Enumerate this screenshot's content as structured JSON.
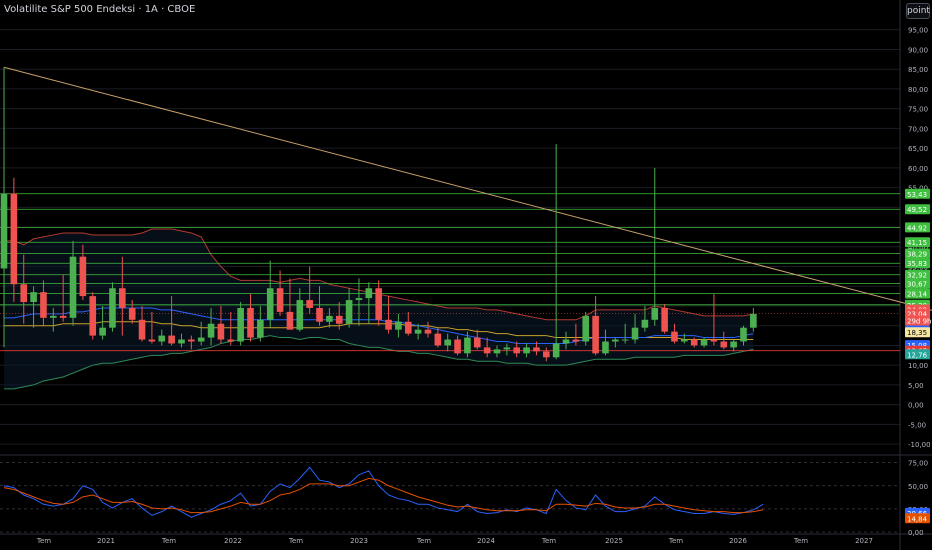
{
  "header": {
    "title": "Volatilite S&P 500 Endeksi · 1A · CBOE",
    "scale_button": "point"
  },
  "colors": {
    "up": "#26a69a",
    "up_fill": "#4caf50",
    "down": "#ef5350",
    "trendline": "#c8a06a",
    "hline": "#3fbf3f",
    "support": "#e53935",
    "bb_upper": "#b23b2f",
    "bb_lower": "#2e8b57",
    "ma_blue": "#2962ff",
    "ma_orange": "#c9a227",
    "grid": "#1a1d24",
    "text": "#d1d4dc"
  },
  "chart_data": [
    {
      "type": "candlestick",
      "title": "Volatilite S&P 500 Endeksi · 1A · CBOE",
      "ylim": [
        -12,
        100
      ],
      "x_tick_labels": [
        "Tem",
        "2021",
        "Tem",
        "2022",
        "Tem",
        "2023",
        "Tem",
        "2024",
        "Tem",
        "2025",
        "Tem",
        "2026",
        "Tem",
        "2027"
      ],
      "y_tick_labels": [
        "95,00",
        "90,00",
        "85,00",
        "80,00",
        "75,00",
        "70,00",
        "65,00",
        "60,00",
        "55,00",
        "50,00",
        "45,00",
        "40,00",
        "35,00",
        "30,00",
        "25,00",
        "20,00",
        "15,00",
        "10,00",
        "5,00",
        "0,00",
        "-5,00",
        "-10,00"
      ],
      "y_ticks": [
        95,
        90,
        85,
        80,
        75,
        70,
        65,
        60,
        55,
        50,
        45,
        40,
        35,
        30,
        25,
        20,
        15,
        10,
        5,
        0,
        -5,
        -10
      ],
      "candles": [
        {
          "o": 34.5,
          "h": 85.5,
          "l": 14.5,
          "c": 53.5
        },
        {
          "o": 53.5,
          "h": 57.5,
          "l": 26.0,
          "c": 30.5
        },
        {
          "o": 30.5,
          "h": 38.0,
          "l": 20.5,
          "c": 26.0
        },
        {
          "o": 26.0,
          "h": 30.0,
          "l": 19.5,
          "c": 28.5
        },
        {
          "o": 28.5,
          "h": 31.5,
          "l": 20.0,
          "c": 22.0
        },
        {
          "o": 22.0,
          "h": 24.5,
          "l": 18.5,
          "c": 22.5
        },
        {
          "o": 22.5,
          "h": 33.0,
          "l": 21.0,
          "c": 22.0
        },
        {
          "o": 22.0,
          "h": 41.5,
          "l": 20.0,
          "c": 37.5
        },
        {
          "o": 37.5,
          "h": 40.5,
          "l": 26.5,
          "c": 27.5
        },
        {
          "o": 27.5,
          "h": 28.5,
          "l": 16.5,
          "c": 17.5
        },
        {
          "o": 17.5,
          "h": 25.0,
          "l": 16.5,
          "c": 19.5
        },
        {
          "o": 19.5,
          "h": 31.0,
          "l": 18.5,
          "c": 29.5
        },
        {
          "o": 29.5,
          "h": 37.5,
          "l": 17.5,
          "c": 24.5
        },
        {
          "o": 24.5,
          "h": 26.5,
          "l": 20.5,
          "c": 21.5
        },
        {
          "o": 21.5,
          "h": 25.0,
          "l": 16.0,
          "c": 16.5
        },
        {
          "o": 16.5,
          "h": 23.5,
          "l": 15.5,
          "c": 16.0
        },
        {
          "o": 16.0,
          "h": 19.0,
          "l": 15.0,
          "c": 17.5
        },
        {
          "o": 17.5,
          "h": 27.5,
          "l": 15.0,
          "c": 15.5
        },
        {
          "o": 15.5,
          "h": 18.0,
          "l": 14.5,
          "c": 16.5
        },
        {
          "o": 16.5,
          "h": 17.5,
          "l": 14.0,
          "c": 16.0
        },
        {
          "o": 16.0,
          "h": 21.0,
          "l": 15.0,
          "c": 17.0
        },
        {
          "o": 17.0,
          "h": 24.5,
          "l": 15.0,
          "c": 20.5
        },
        {
          "o": 20.5,
          "h": 25.0,
          "l": 15.5,
          "c": 16.5
        },
        {
          "o": 16.5,
          "h": 23.5,
          "l": 15.0,
          "c": 16.0
        },
        {
          "o": 16.0,
          "h": 26.0,
          "l": 15.0,
          "c": 24.5
        },
        {
          "o": 24.5,
          "h": 28.0,
          "l": 16.0,
          "c": 17.0
        },
        {
          "o": 17.0,
          "h": 25.0,
          "l": 16.0,
          "c": 21.5
        },
        {
          "o": 21.5,
          "h": 36.5,
          "l": 19.5,
          "c": 29.5
        },
        {
          "o": 29.5,
          "h": 34.0,
          "l": 22.5,
          "c": 23.5
        },
        {
          "o": 23.5,
          "h": 32.0,
          "l": 19.5,
          "c": 19.0
        },
        {
          "o": 19.0,
          "h": 29.5,
          "l": 18.5,
          "c": 26.5
        },
        {
          "o": 26.5,
          "h": 35.0,
          "l": 23.0,
          "c": 24.5
        },
        {
          "o": 24.5,
          "h": 30.0,
          "l": 20.0,
          "c": 21.0
        },
        {
          "o": 21.0,
          "h": 24.5,
          "l": 19.5,
          "c": 22.5
        },
        {
          "o": 22.5,
          "h": 26.0,
          "l": 19.0,
          "c": 20.5
        },
        {
          "o": 20.5,
          "h": 29.5,
          "l": 19.5,
          "c": 26.5
        },
        {
          "o": 26.5,
          "h": 32.0,
          "l": 20.0,
          "c": 27.0
        },
        {
          "o": 27.0,
          "h": 31.0,
          "l": 20.5,
          "c": 29.5
        },
        {
          "o": 29.5,
          "h": 31.5,
          "l": 20.0,
          "c": 21.5
        },
        {
          "o": 21.5,
          "h": 27.5,
          "l": 18.0,
          "c": 19.0
        },
        {
          "o": 19.0,
          "h": 23.0,
          "l": 17.0,
          "c": 21.0
        },
        {
          "o": 21.0,
          "h": 23.5,
          "l": 17.5,
          "c": 18.0
        },
        {
          "o": 18.0,
          "h": 20.5,
          "l": 16.5,
          "c": 19.0
        },
        {
          "o": 19.0,
          "h": 21.0,
          "l": 17.0,
          "c": 18.0
        },
        {
          "o": 18.0,
          "h": 19.5,
          "l": 14.5,
          "c": 15.0
        },
        {
          "o": 15.0,
          "h": 18.0,
          "l": 13.5,
          "c": 16.5
        },
        {
          "o": 16.5,
          "h": 17.5,
          "l": 12.5,
          "c": 13.0
        },
        {
          "o": 13.0,
          "h": 18.5,
          "l": 12.0,
          "c": 17.0
        },
        {
          "o": 17.0,
          "h": 19.0,
          "l": 14.0,
          "c": 14.5
        },
        {
          "o": 14.5,
          "h": 17.0,
          "l": 12.0,
          "c": 13.0
        },
        {
          "o": 13.0,
          "h": 15.0,
          "l": 12.0,
          "c": 14.0
        },
        {
          "o": 14.0,
          "h": 15.5,
          "l": 12.5,
          "c": 14.5
        },
        {
          "o": 14.5,
          "h": 16.0,
          "l": 12.0,
          "c": 13.0
        },
        {
          "o": 13.0,
          "h": 15.5,
          "l": 12.0,
          "c": 14.5
        },
        {
          "o": 14.5,
          "h": 16.0,
          "l": 12.5,
          "c": 13.5
        },
        {
          "o": 13.5,
          "h": 14.5,
          "l": 11.0,
          "c": 12.0
        },
        {
          "o": 12.0,
          "h": 66.0,
          "l": 11.5,
          "c": 15.5
        },
        {
          "o": 15.5,
          "h": 18.5,
          "l": 14.0,
          "c": 16.5
        },
        {
          "o": 16.5,
          "h": 20.5,
          "l": 15.0,
          "c": 16.0
        },
        {
          "o": 16.0,
          "h": 23.5,
          "l": 15.0,
          "c": 22.5
        },
        {
          "o": 22.5,
          "h": 27.5,
          "l": 12.5,
          "c": 13.0
        },
        {
          "o": 13.0,
          "h": 19.0,
          "l": 12.5,
          "c": 16.0
        },
        {
          "o": 16.0,
          "h": 17.0,
          "l": 14.5,
          "c": 16.5
        },
        {
          "o": 16.5,
          "h": 20.5,
          "l": 15.5,
          "c": 16.5
        },
        {
          "o": 16.5,
          "h": 23.0,
          "l": 15.5,
          "c": 19.5
        },
        {
          "o": 19.5,
          "h": 25.0,
          "l": 18.5,
          "c": 21.5
        },
        {
          "o": 21.5,
          "h": 60.0,
          "l": 20.0,
          "c": 24.5
        },
        {
          "o": 24.5,
          "h": 25.5,
          "l": 18.0,
          "c": 18.5
        },
        {
          "o": 18.5,
          "h": 20.5,
          "l": 15.5,
          "c": 16.0
        },
        {
          "o": 16.0,
          "h": 18.0,
          "l": 15.5,
          "c": 16.5
        },
        {
          "o": 16.5,
          "h": 17.0,
          "l": 14.5,
          "c": 15.0
        },
        {
          "o": 15.0,
          "h": 17.0,
          "l": 14.5,
          "c": 16.5
        },
        {
          "o": 16.5,
          "h": 28.0,
          "l": 15.0,
          "c": 16.0
        },
        {
          "o": 16.0,
          "h": 18.5,
          "l": 14.0,
          "c": 14.5
        },
        {
          "o": 14.5,
          "h": 16.5,
          "l": 13.5,
          "c": 16.0
        },
        {
          "o": 16.0,
          "h": 20.0,
          "l": 15.0,
          "c": 19.5
        },
        {
          "o": 19.5,
          "h": 24.5,
          "l": 18.5,
          "c": 23.0
        }
      ],
      "horizontal_levels": [
        53.43,
        49.52,
        44.92,
        41.15,
        38.29,
        35.83,
        32.92,
        30.67,
        28.14,
        25.3
      ],
      "support_level": 13.67,
      "trendline": {
        "from": [
          0,
          85.5
        ],
        "to": [
          110,
          13.5
        ]
      },
      "bb_upper": [
        41.5,
        41.5,
        40.5,
        42.0,
        42.5,
        43.0,
        43.5,
        43.5,
        43.5,
        43.0,
        43.0,
        43.0,
        43.0,
        43.0,
        43.5,
        44.5,
        44.5,
        44.5,
        44.0,
        43.5,
        42.5,
        38.0,
        35.0,
        32.5,
        31.5,
        31.5,
        31.5,
        31.5,
        31.0,
        31.5,
        32.0,
        31.5,
        31.5,
        30.5,
        30.0,
        29.5,
        29.0,
        28.5,
        28.0,
        27.5,
        27.0,
        26.5,
        26.0,
        25.5,
        25.0,
        24.5,
        24.5,
        24.5,
        24.5,
        24.0,
        24.0,
        23.5,
        23.0,
        22.5,
        22.0,
        21.5,
        21.5,
        21.5,
        21.5,
        22.5,
        24.0,
        24.0,
        24.0,
        24.0,
        24.0,
        24.0,
        25.0,
        24.5,
        24.0,
        23.5,
        23.0,
        22.5,
        22.5,
        22.5,
        22.5,
        22.5,
        23.0
      ],
      "bb_lower": [
        4.0,
        4.0,
        4.5,
        5.0,
        6.0,
        6.5,
        7.0,
        8.0,
        9.0,
        10.0,
        10.5,
        10.5,
        11.0,
        11.5,
        12.0,
        12.5,
        12.5,
        13.0,
        13.0,
        13.5,
        14.0,
        14.5,
        15.5,
        16.0,
        16.5,
        16.5,
        17.0,
        17.5,
        17.0,
        17.0,
        16.5,
        17.0,
        17.0,
        16.5,
        16.5,
        15.5,
        15.0,
        14.5,
        14.5,
        14.0,
        13.5,
        13.5,
        13.0,
        13.0,
        12.5,
        12.0,
        11.5,
        11.5,
        11.0,
        11.0,
        11.0,
        10.5,
        10.5,
        10.5,
        10.0,
        10.0,
        10.0,
        10.0,
        10.5,
        11.0,
        11.5,
        11.5,
        11.5,
        11.5,
        12.0,
        12.0,
        12.0,
        12.0,
        12.0,
        12.5,
        12.5,
        12.5,
        12.5,
        12.5,
        13.0,
        13.5,
        14.0
      ],
      "ma_blue": [
        22.0,
        22.0,
        22.5,
        23.0,
        23.0,
        23.0,
        23.0,
        23.5,
        23.5,
        24.0,
        24.5,
        24.5,
        24.5,
        24.5,
        24.5,
        24.5,
        24.0,
        24.0,
        23.5,
        23.0,
        22.5,
        22.0,
        21.5,
        21.5,
        21.5,
        21.5,
        21.5,
        21.5,
        21.5,
        21.5,
        21.5,
        21.5,
        21.5,
        21.5,
        21.5,
        21.5,
        21.5,
        21.5,
        21.5,
        21.0,
        21.0,
        20.5,
        20.0,
        19.5,
        19.0,
        18.5,
        18.0,
        17.5,
        17.0,
        16.5,
        16.0,
        16.0,
        15.5,
        15.5,
        15.5,
        15.5,
        15.5,
        15.5,
        16.0,
        16.5,
        17.0,
        17.0,
        17.0,
        17.0,
        17.0,
        17.0,
        17.5,
        17.5,
        17.5,
        17.5,
        17.5,
        17.0,
        17.0,
        17.0,
        17.0,
        17.5,
        18.0
      ],
      "ma_orange": [
        20.0,
        20.0,
        20.0,
        20.0,
        20.0,
        20.0,
        20.5,
        20.5,
        20.5,
        20.5,
        21.0,
        21.0,
        21.0,
        21.0,
        21.0,
        21.0,
        20.5,
        20.5,
        20.0,
        20.0,
        19.5,
        19.5,
        19.5,
        19.5,
        19.5,
        19.5,
        19.5,
        19.5,
        19.5,
        19.5,
        19.5,
        19.5,
        19.5,
        20.0,
        20.0,
        20.5,
        20.5,
        20.5,
        20.5,
        20.5,
        20.5,
        20.0,
        20.0,
        20.0,
        19.5,
        19.5,
        19.0,
        19.0,
        18.5,
        18.5,
        18.0,
        18.0,
        17.5,
        17.5,
        17.5,
        17.5,
        17.0,
        17.0,
        17.0,
        17.0,
        17.0,
        17.0,
        17.0,
        17.0,
        17.0,
        17.0,
        17.0,
        17.0,
        17.0,
        16.5,
        16.5,
        16.5,
        16.5,
        16.5,
        16.5,
        16.5,
        16.5
      ],
      "price_labels": [
        {
          "text": "53,43",
          "value": 53.43,
          "bg": "#3fbf3f"
        },
        {
          "text": "49,52",
          "value": 49.52,
          "bg": "#3fbf3f"
        },
        {
          "text": "44,92",
          "value": 44.92,
          "bg": "#3fbf3f"
        },
        {
          "text": "41,15",
          "value": 41.15,
          "bg": "#3fbf3f"
        },
        {
          "text": "38,29",
          "value": 38.29,
          "bg": "#3fbf3f"
        },
        {
          "text": "35,83",
          "value": 35.83,
          "bg": "#3fbf3f"
        },
        {
          "text": "32,92",
          "value": 32.92,
          "bg": "#3fbf3f"
        },
        {
          "text": "30,67",
          "value": 30.67,
          "bg": "#3fbf3f"
        },
        {
          "text": "28,14",
          "value": 28.14,
          "bg": "#3fbf3f"
        },
        {
          "text": "25,30",
          "value": 25.3,
          "bg": "#3fbf3f"
        },
        {
          "text": "24,09",
          "value": 24.09,
          "bg": "#ef5350"
        },
        {
          "text": "23,04",
          "value": 23.04,
          "bg": "#ef5350"
        },
        {
          "text": "29d 9h",
          "value": 21.3,
          "bg": "#ef5350"
        },
        {
          "text": "18,78",
          "value": 18.78,
          "bg": "#2962ff"
        },
        {
          "text": "18,35",
          "value": 18.35,
          "bg": "#f5e6a3",
          "fg": "#000000"
        },
        {
          "text": "15,08",
          "value": 15.08,
          "bg": "#2962ff"
        },
        {
          "text": "13,67",
          "value": 13.67,
          "bg": "#e53935"
        },
        {
          "text": "12,76",
          "value": 12.76,
          "bg": "#26a69a"
        }
      ]
    },
    {
      "type": "line",
      "ylim": [
        0,
        80
      ],
      "y_ticks": [
        75,
        50,
        25,
        0
      ],
      "y_tick_labels": [
        "75,00",
        "50,00",
        "25,00",
        "0,00"
      ],
      "series": [
        {
          "color": "#2962ff",
          "values": [
            50,
            48,
            40,
            36,
            30,
            28,
            30,
            36,
            50,
            46,
            32,
            26,
            32,
            36,
            26,
            18,
            22,
            28,
            22,
            16,
            20,
            24,
            30,
            34,
            42,
            28,
            30,
            44,
            52,
            48,
            58,
            70,
            56,
            54,
            48,
            52,
            62,
            66,
            50,
            40,
            36,
            34,
            30,
            30,
            26,
            24,
            22,
            30,
            22,
            20,
            21,
            24,
            22,
            26,
            24,
            20,
            46,
            34,
            26,
            24,
            40,
            28,
            22,
            22,
            25,
            28,
            38,
            30,
            24,
            22,
            20,
            20,
            22,
            20,
            19,
            21,
            24,
            30
          ]
        },
        {
          "color": "#e65100",
          "values": [
            48,
            46,
            42,
            38,
            34,
            31,
            30,
            32,
            38,
            40,
            36,
            32,
            32,
            33,
            30,
            26,
            25,
            26,
            24,
            21,
            21,
            22,
            25,
            28,
            32,
            30,
            30,
            34,
            40,
            42,
            46,
            52,
            52,
            52,
            50,
            50,
            54,
            58,
            56,
            50,
            46,
            42,
            38,
            35,
            32,
            29,
            27,
            28,
            26,
            24,
            23,
            23,
            23,
            24,
            24,
            23,
            30,
            30,
            29,
            28,
            31,
            30,
            27,
            26,
            26,
            27,
            30,
            30,
            28,
            26,
            24,
            23,
            22,
            22,
            21,
            21,
            22,
            24
          ]
        }
      ],
      "price_labels": [
        {
          "text": "20,66",
          "value": 20.66,
          "bg": "#2962ff"
        },
        {
          "text": "14,84",
          "value": 14.84,
          "bg": "#e65100"
        }
      ]
    }
  ]
}
